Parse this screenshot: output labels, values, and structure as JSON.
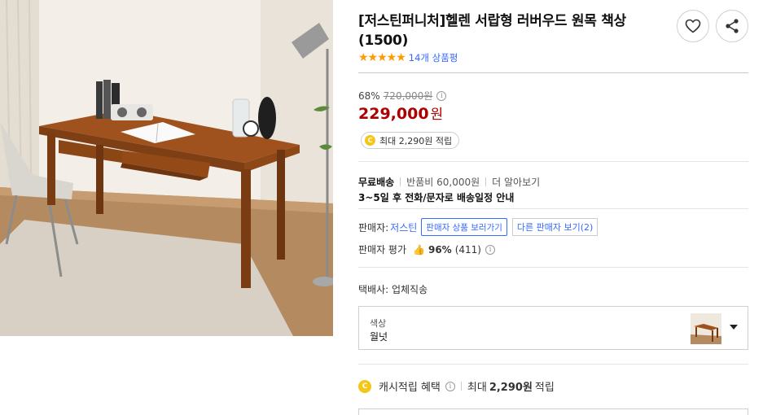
{
  "product": {
    "title": "[저스틴퍼니처]헬렌 서랍형 러버우드 원목 책상(1500)",
    "stars_glyph": "★★★★★",
    "review_count": "14개 상품평",
    "image_icon": "desk-photo"
  },
  "actions": {
    "like_icon": "heart-icon",
    "share_icon": "share-icon"
  },
  "price": {
    "discount": "68%",
    "original": "720,000원",
    "info_glyph": "i",
    "sale": "229,000",
    "sale_unit": "원",
    "color": "#ae0000"
  },
  "cash_badge": {
    "coin_glyph": "C",
    "text": "최대 2,290원 적립"
  },
  "shipping": {
    "free_label": "무료배송",
    "return_fee": "반품비 60,000원",
    "more": "더 알아보기",
    "schedule": "3~5일 후 전화/문자로 배송일정 안내"
  },
  "seller": {
    "label": "판매자:",
    "name": "저스틴",
    "view_products_tooltip": "판매자 상품 보러가기",
    "other_sellers": "다른 판매자 보기(2)",
    "rating_label": "판매자 평가",
    "thumb_glyph": "👍",
    "rating_percent": "96%",
    "rating_count": "(411)"
  },
  "delivery": {
    "label": "택배사: 업체직송"
  },
  "option": {
    "label": "색상",
    "value": "월넛"
  },
  "cash_benefit": {
    "coin_glyph": "C",
    "label": "캐시적립 혜택",
    "info_glyph": "i",
    "prefix": "최대",
    "amount": "2,290원",
    "suffix": "적립"
  },
  "colors": {
    "link": "#346aff",
    "star": "#ff9a00",
    "coin": "#f5c518"
  }
}
